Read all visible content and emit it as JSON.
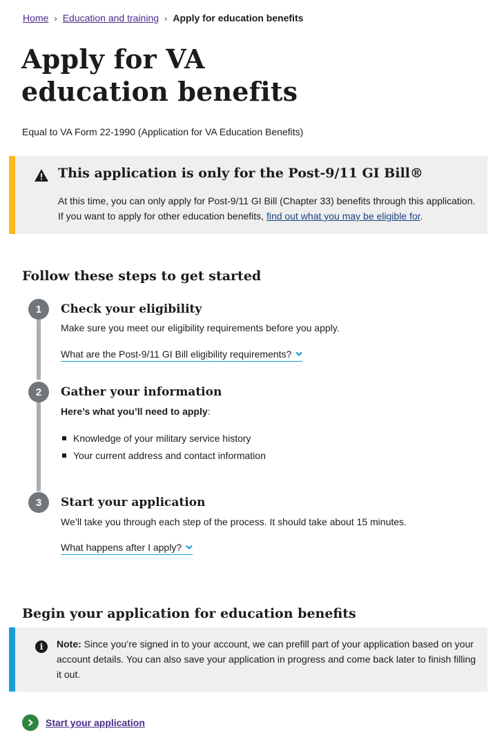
{
  "breadcrumb": {
    "items": [
      "Home",
      "Education and training"
    ],
    "current": "Apply for education benefits"
  },
  "page": {
    "title": "Apply for VA education benefits",
    "subtitle": "Equal to VA Form 22-1990 (Application for VA Education Benefits)"
  },
  "warning_alert": {
    "heading": "This application is only for the Post-9/11 GI Bill®",
    "body_before": "At this time, you can only apply for Post-9/11 GI Bill (Chapter 33) benefits through this application. If you want to apply for other education benefits, ",
    "link": "find out what you may be eligible for",
    "body_after": "."
  },
  "steps_section": {
    "heading": "Follow these steps to get started",
    "steps": [
      {
        "number": "1",
        "title": "Check your eligibility",
        "text": "Make sure you meet our eligibility requirements before you apply.",
        "accordion": "What are the Post-9/11 GI Bill eligibility requirements?"
      },
      {
        "number": "2",
        "title": "Gather your information",
        "lead_bold": "Here’s what you’ll need to apply",
        "lead_after": ":",
        "bullets": [
          "Knowledge of your military service history",
          "Your current address and contact information"
        ]
      },
      {
        "number": "3",
        "title": "Start your application",
        "text": "We’ll take you through each step of the process. It should take about 15 minutes.",
        "accordion": "What happens after I apply?"
      }
    ]
  },
  "begin_section": {
    "heading": "Begin your application for education benefits",
    "note_label": "Note:",
    "note_text": " Since you’re signed in to your account, we can prefill part of your application based on your account details. You can also save your application in progress and come back later to finish filling it out.",
    "start_link": "Start your application"
  },
  "colors": {
    "warning_accent": "#fdb81e",
    "info_accent": "#1a9dd6",
    "step_circle": "#71767a",
    "start_icon": "#2e8540",
    "link_visited": "#4a2b8a"
  },
  "icons": {
    "warning": "warning-triangle-icon",
    "info": "info-circle-icon",
    "chevron": "chevron-down-icon",
    "start": "chevron-right-circle-icon"
  }
}
